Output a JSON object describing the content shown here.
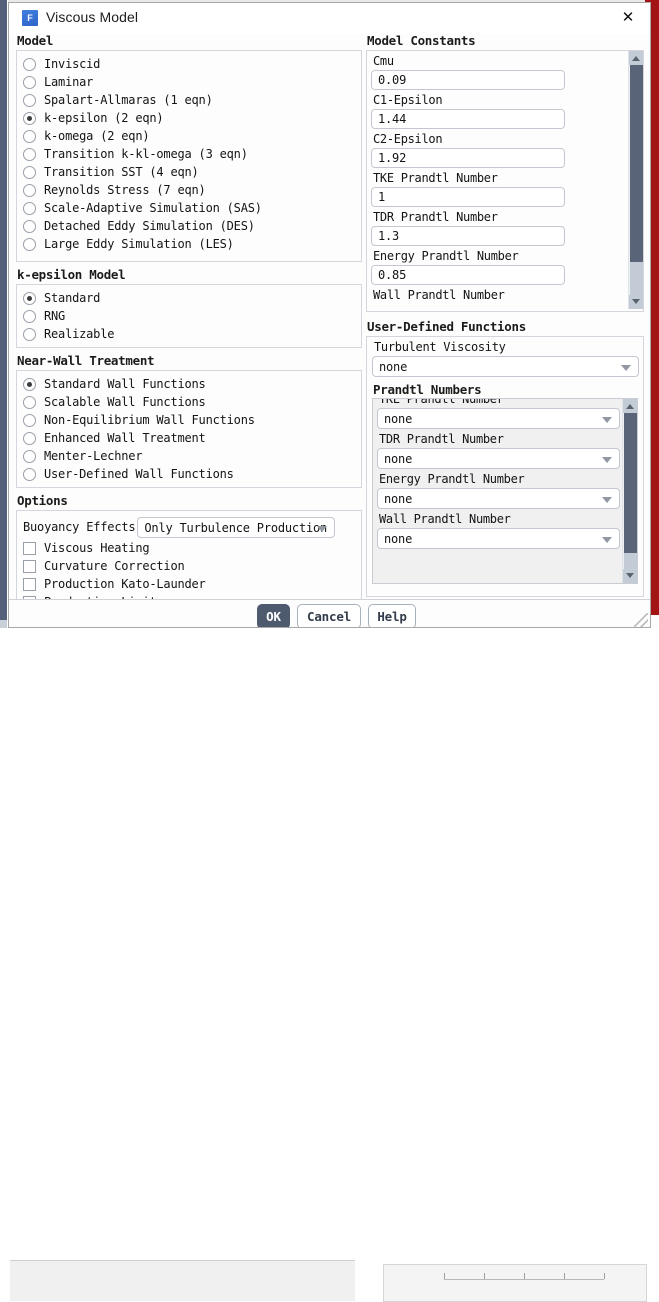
{
  "window": {
    "title": "Viscous Model",
    "icon": "fluent-f-icon",
    "close_label": "✕"
  },
  "model": {
    "group_title": "Model",
    "items": [
      {
        "label": "Inviscid",
        "selected": false
      },
      {
        "label": "Laminar",
        "selected": false
      },
      {
        "label": "Spalart-Allmaras (1 eqn)",
        "selected": false
      },
      {
        "label": "k-epsilon (2 eqn)",
        "selected": true
      },
      {
        "label": "k-omega (2 eqn)",
        "selected": false
      },
      {
        "label": "Transition k-kl-omega (3 eqn)",
        "selected": false
      },
      {
        "label": "Transition SST (4 eqn)",
        "selected": false
      },
      {
        "label": "Reynolds Stress (7 eqn)",
        "selected": false
      },
      {
        "label": "Scale-Adaptive Simulation (SAS)",
        "selected": false
      },
      {
        "label": "Detached Eddy Simulation (DES)",
        "selected": false
      },
      {
        "label": "Large Eddy Simulation (LES)",
        "selected": false
      }
    ]
  },
  "kepsilon_model": {
    "group_title": "k-epsilon Model",
    "items": [
      {
        "label": "Standard",
        "selected": true
      },
      {
        "label": "RNG",
        "selected": false
      },
      {
        "label": "Realizable",
        "selected": false
      }
    ]
  },
  "near_wall_treatment": {
    "group_title": "Near-Wall Treatment",
    "items": [
      {
        "label": "Standard Wall Functions",
        "selected": true
      },
      {
        "label": "Scalable Wall Functions",
        "selected": false
      },
      {
        "label": "Non-Equilibrium Wall Functions",
        "selected": false
      },
      {
        "label": "Enhanced Wall Treatment",
        "selected": false
      },
      {
        "label": "Menter-Lechner",
        "selected": false
      },
      {
        "label": "User-Defined Wall Functions",
        "selected": false
      }
    ]
  },
  "options": {
    "group_title": "Options",
    "buoyancy_label": "Buoyancy Effects",
    "buoyancy_value": "Only Turbulence Production",
    "checkboxes": [
      {
        "label": "Viscous Heating",
        "checked": false
      },
      {
        "label": "Curvature Correction",
        "checked": false
      },
      {
        "label": "Production Kato-Launder",
        "checked": false
      },
      {
        "label": "Production Limiter",
        "checked": false
      }
    ]
  },
  "model_constants": {
    "group_title": "Model Constants",
    "fields": [
      {
        "label": "Cmu",
        "value": "0.09"
      },
      {
        "label": "C1-Epsilon",
        "value": "1.44"
      },
      {
        "label": "C2-Epsilon",
        "value": "1.92"
      },
      {
        "label": "TKE Prandtl Number",
        "value": "1"
      },
      {
        "label": "TDR Prandtl Number",
        "value": "1.3"
      },
      {
        "label": "Energy Prandtl Number",
        "value": "0.85"
      }
    ],
    "clipped_label": "Wall Prandtl Number"
  },
  "udf": {
    "group_title": "User-Defined Functions",
    "turbulent_viscosity_label": "Turbulent Viscosity",
    "turbulent_viscosity_value": "none",
    "prandtl_group_title": "Prandtl Numbers",
    "prandtl_fields": [
      {
        "label": "TKE Prandtl Number",
        "value": "none"
      },
      {
        "label": "TDR Prandtl Number",
        "value": "none"
      },
      {
        "label": "Energy Prandtl Number",
        "value": "none"
      },
      {
        "label": "Wall Prandtl Number",
        "value": "none"
      }
    ]
  },
  "footer": {
    "ok": "OK",
    "cancel": "Cancel",
    "help": "Help"
  },
  "colors": {
    "accent": "#4e5a6e",
    "scroll_thumb": "#5a6478",
    "scroll_track": "#c3ccd6",
    "bg_red_band": "#a31515",
    "icon_blue": "#2f63c8"
  }
}
